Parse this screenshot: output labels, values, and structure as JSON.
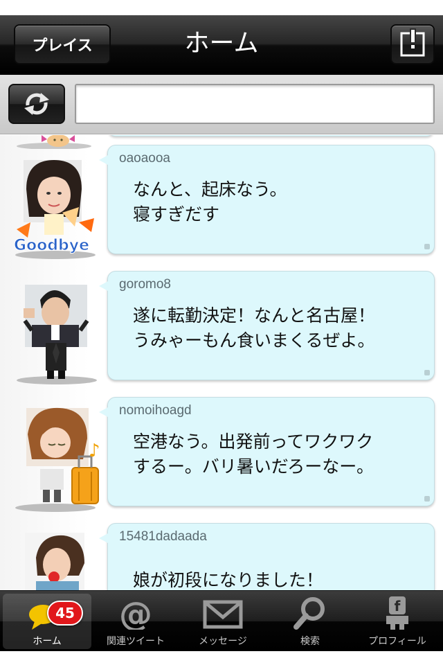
{
  "nav": {
    "left_button": "プレイス",
    "title": "ホーム",
    "compose_icon": "compose-icon"
  },
  "search": {
    "refresh_icon": "refresh-icon",
    "value": ""
  },
  "posts": [
    {
      "username": "oaoaooa",
      "message": "なんと、起床なう。\n寝すぎだす",
      "avatar_icon": "girl-avatar-goodbye"
    },
    {
      "username": "goromo8",
      "message": "遂に転勤決定！なんと名古屋！\nうみゃーもん食いまくるぜよ。",
      "avatar_icon": "businessman-avatar"
    },
    {
      "username": "nomoihoagd",
      "message": "空港なう。出発前ってワクワク\nするー。バリ暑いだろーなー。",
      "avatar_icon": "traveler-avatar"
    },
    {
      "username": "15481dadaada",
      "message": "娘が初段になりました！",
      "avatar_icon": "woman-avatar"
    }
  ],
  "tabs": [
    {
      "label": "ホーム",
      "icon": "speech-bubble-icon",
      "badge": "45",
      "active": true
    },
    {
      "label": "関連ツイート",
      "icon": "at-sign-icon",
      "active": false
    },
    {
      "label": "メッセージ",
      "icon": "envelope-icon",
      "active": false
    },
    {
      "label": "検索",
      "icon": "magnifier-icon",
      "active": false
    },
    {
      "label": "プロフィール",
      "icon": "profile-figure-icon",
      "active": false
    }
  ]
}
